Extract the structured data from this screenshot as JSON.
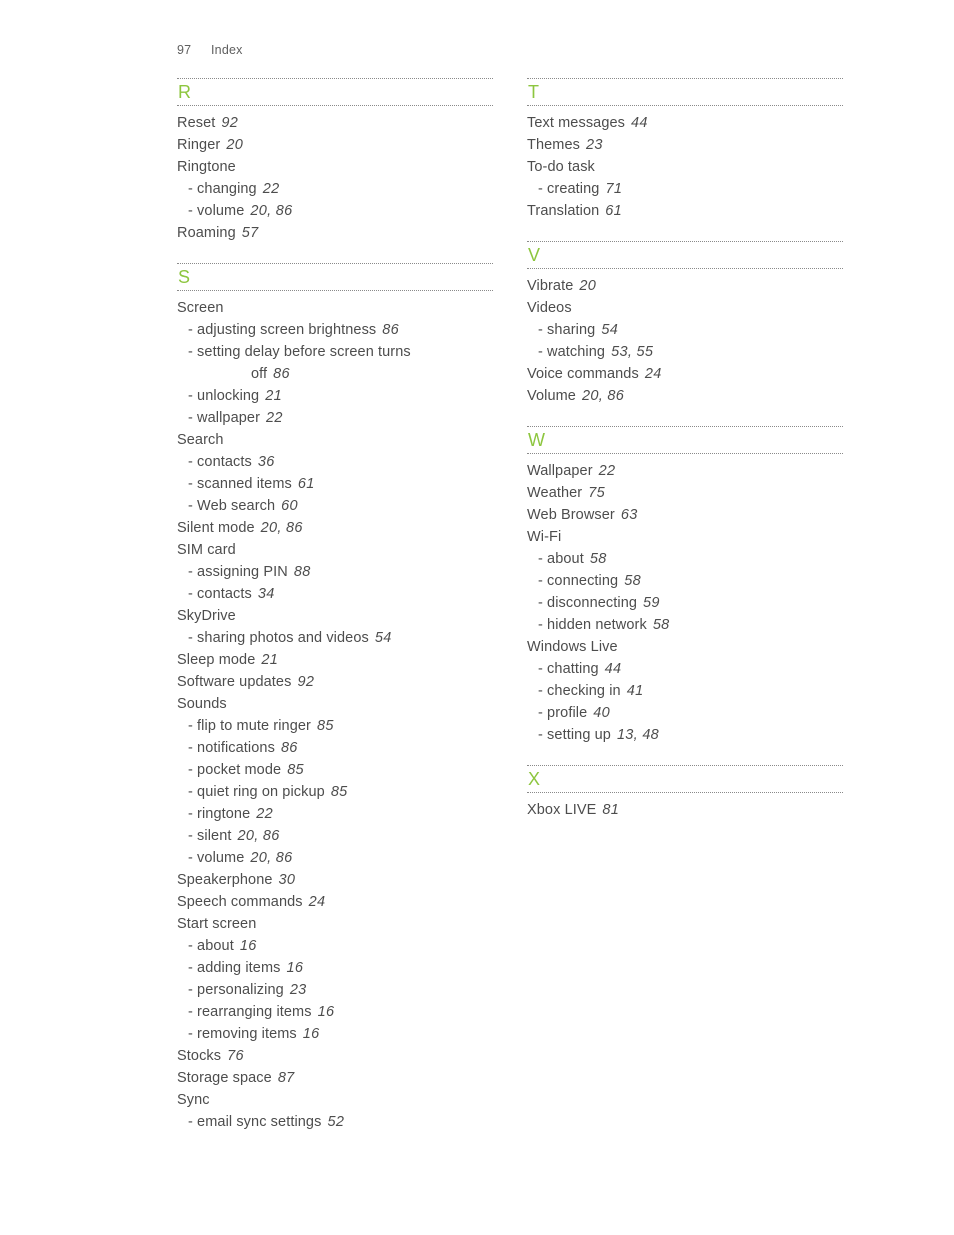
{
  "header": {
    "folio": "97",
    "label": "Index"
  },
  "columns": [
    {
      "name": "left-column",
      "groups": [
        {
          "letter": "R",
          "entries": [
            {
              "level": "main",
              "term": "Reset",
              "pages": "92"
            },
            {
              "level": "main",
              "term": "Ringer",
              "pages": "20"
            },
            {
              "level": "main",
              "term": "Ringtone",
              "pages": ""
            },
            {
              "level": "sub",
              "term": "- changing",
              "pages": "22"
            },
            {
              "level": "sub",
              "term": "- volume",
              "pages": "20, 86"
            },
            {
              "level": "main",
              "term": "Roaming",
              "pages": "57"
            }
          ]
        },
        {
          "letter": "S",
          "entries": [
            {
              "level": "main",
              "term": "Screen",
              "pages": ""
            },
            {
              "level": "sub",
              "term": "- adjusting screen brightness",
              "pages": "86"
            },
            {
              "level": "sub",
              "term": "- setting delay before screen turns",
              "pages": ""
            },
            {
              "level": "cont",
              "term": "off",
              "pages": "86"
            },
            {
              "level": "sub",
              "term": "- unlocking",
              "pages": "21"
            },
            {
              "level": "sub",
              "term": "- wallpaper",
              "pages": "22"
            },
            {
              "level": "main",
              "term": "Search",
              "pages": ""
            },
            {
              "level": "sub",
              "term": "- contacts",
              "pages": "36"
            },
            {
              "level": "sub",
              "term": "- scanned items",
              "pages": "61"
            },
            {
              "level": "sub",
              "term": "- Web search",
              "pages": "60"
            },
            {
              "level": "main",
              "term": "Silent mode",
              "pages": "20, 86"
            },
            {
              "level": "main",
              "term": "SIM card",
              "pages": ""
            },
            {
              "level": "sub",
              "term": "- assigning PIN",
              "pages": "88"
            },
            {
              "level": "sub",
              "term": "- contacts",
              "pages": "34"
            },
            {
              "level": "main",
              "term": "SkyDrive",
              "pages": ""
            },
            {
              "level": "sub",
              "term": "- sharing photos and videos",
              "pages": "54"
            },
            {
              "level": "main",
              "term": "Sleep mode",
              "pages": "21"
            },
            {
              "level": "main",
              "term": "Software updates",
              "pages": "92"
            },
            {
              "level": "main",
              "term": "Sounds",
              "pages": ""
            },
            {
              "level": "sub",
              "term": "- flip to mute ringer",
              "pages": "85"
            },
            {
              "level": "sub",
              "term": "- notifications",
              "pages": "86"
            },
            {
              "level": "sub",
              "term": "- pocket mode",
              "pages": "85"
            },
            {
              "level": "sub",
              "term": "- quiet ring on pickup",
              "pages": "85"
            },
            {
              "level": "sub",
              "term": "- ringtone",
              "pages": "22"
            },
            {
              "level": "sub",
              "term": "- silent",
              "pages": "20, 86"
            },
            {
              "level": "sub",
              "term": "- volume",
              "pages": "20, 86"
            },
            {
              "level": "main",
              "term": "Speakerphone",
              "pages": "30"
            },
            {
              "level": "main",
              "term": "Speech commands",
              "pages": "24"
            },
            {
              "level": "main",
              "term": "Start screen",
              "pages": ""
            },
            {
              "level": "sub",
              "term": "- about",
              "pages": "16"
            },
            {
              "level": "sub",
              "term": "- adding items",
              "pages": "16"
            },
            {
              "level": "sub",
              "term": "- personalizing",
              "pages": "23"
            },
            {
              "level": "sub",
              "term": "- rearranging items",
              "pages": "16"
            },
            {
              "level": "sub",
              "term": "- removing items",
              "pages": "16"
            },
            {
              "level": "main",
              "term": "Stocks",
              "pages": "76"
            },
            {
              "level": "main",
              "term": "Storage space",
              "pages": "87"
            },
            {
              "level": "main",
              "term": "Sync",
              "pages": ""
            },
            {
              "level": "sub",
              "term": "- email sync settings",
              "pages": "52"
            }
          ]
        }
      ]
    },
    {
      "name": "right-column",
      "groups": [
        {
          "letter": "T",
          "entries": [
            {
              "level": "main",
              "term": "Text messages",
              "pages": "44"
            },
            {
              "level": "main",
              "term": "Themes",
              "pages": "23"
            },
            {
              "level": "main",
              "term": "To-do task",
              "pages": ""
            },
            {
              "level": "sub",
              "term": "- creating",
              "pages": "71"
            },
            {
              "level": "main",
              "term": "Translation",
              "pages": "61"
            }
          ]
        },
        {
          "letter": "V",
          "entries": [
            {
              "level": "main",
              "term": "Vibrate",
              "pages": "20"
            },
            {
              "level": "main",
              "term": "Videos",
              "pages": ""
            },
            {
              "level": "sub",
              "term": "- sharing",
              "pages": "54"
            },
            {
              "level": "sub",
              "term": "- watching",
              "pages": "53, 55"
            },
            {
              "level": "main",
              "term": "Voice commands",
              "pages": "24"
            },
            {
              "level": "main",
              "term": "Volume",
              "pages": "20, 86"
            }
          ]
        },
        {
          "letter": "W",
          "entries": [
            {
              "level": "main",
              "term": "Wallpaper",
              "pages": "22"
            },
            {
              "level": "main",
              "term": "Weather",
              "pages": "75"
            },
            {
              "level": "main",
              "term": "Web Browser",
              "pages": "63"
            },
            {
              "level": "main",
              "term": "Wi-Fi",
              "pages": ""
            },
            {
              "level": "sub",
              "term": "- about",
              "pages": "58"
            },
            {
              "level": "sub",
              "term": "- connecting",
              "pages": "58"
            },
            {
              "level": "sub",
              "term": "- disconnecting",
              "pages": "59"
            },
            {
              "level": "sub",
              "term": "- hidden network",
              "pages": "58"
            },
            {
              "level": "main",
              "term": "Windows Live",
              "pages": ""
            },
            {
              "level": "sub",
              "term": "- chatting",
              "pages": "44"
            },
            {
              "level": "sub",
              "term": "- checking in",
              "pages": "41"
            },
            {
              "level": "sub",
              "term": "- profile",
              "pages": "40"
            },
            {
              "level": "sub",
              "term": "- setting up",
              "pages": "13, 48"
            }
          ]
        },
        {
          "letter": "X",
          "entries": [
            {
              "level": "main",
              "term": "Xbox LIVE",
              "pages": "81"
            }
          ]
        }
      ]
    }
  ],
  "colors": {
    "letter_accent": "#8dc63f",
    "text": "#4d4d4d",
    "rule": "#8a8a8a"
  }
}
